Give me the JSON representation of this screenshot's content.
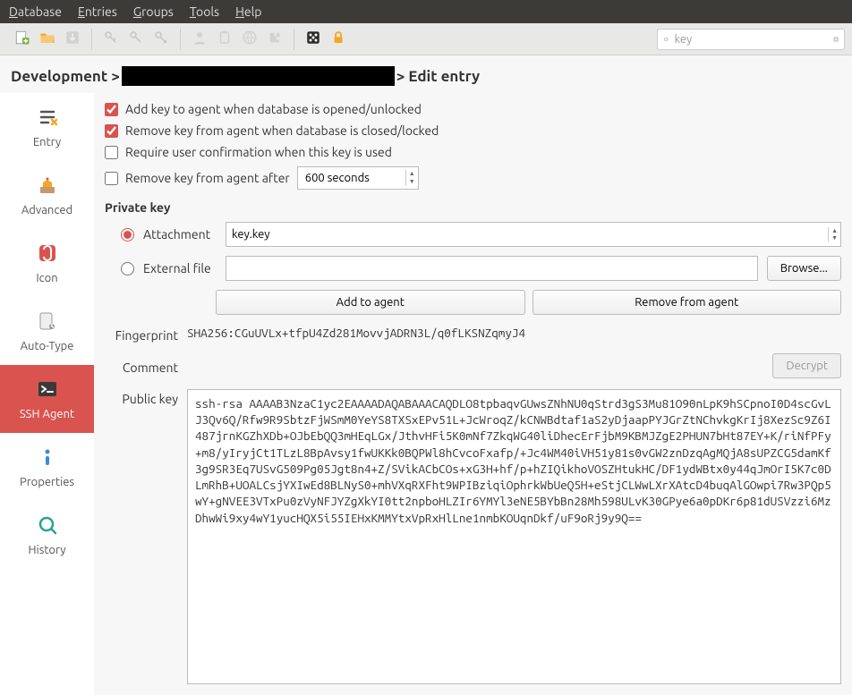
{
  "menu": {
    "database": "Database",
    "entries": "Entries",
    "groups": "Groups",
    "tools": "Tools",
    "help": "Help"
  },
  "search": {
    "placeholder": "key"
  },
  "breadcrumb": {
    "root": "Development",
    "tail": "Edit entry"
  },
  "tabs": {
    "entry": "Entry",
    "advanced": "Advanced",
    "icon": "Icon",
    "autotype": "Auto-Type",
    "sshagent": "SSH Agent",
    "properties": "Properties",
    "history": "History"
  },
  "ssh": {
    "add_open": "Add key to agent when database is opened/unlocked",
    "remove_close": "Remove key from agent when database is closed/locked",
    "require_confirm": "Require user confirmation when this key is used",
    "remove_after": "Remove key from agent after",
    "remove_after_value": "600 seconds",
    "private_key": "Private key",
    "attachment": "Attachment",
    "attachment_value": "key.key",
    "external": "External file",
    "browse": "Browse...",
    "add_agent": "Add to agent",
    "remove_agent": "Remove from agent",
    "fingerprint": "Fingerprint",
    "fingerprint_value": "SHA256:CGuUVLx+tfpU4Zd281MovvjADRN3L/q0fLKSNZqmyJ4",
    "comment": "Comment",
    "decrypt": "Decrypt",
    "public_key": "Public key",
    "public_key_value": "ssh-rsa AAAAB3NzaC1yc2EAAAADAQABAAACAQDLO8tpbaqvGUwsZNhNU0qStrd3gS3Mu81O90nLpK9hSCpnoI0D4scGvLJ3Qv6Q/Rfw9R9SbtzFjWSmM0YeYS8TXSxEPv51L+JcWroqZ/kCNWBdtaf1aS2yDjaapPYJGrZtNChvkgKrIj8XezSc9Z6I487jrnKGZhXDb+OJbEbQQ3mHEqLGx/JthvHFi5K0mNf7ZkqWG40liDhecErFjbM9KBMJZgE2PHUN7bHt87EY+K/riNfPFy+m8/yIryjCt1TLzL8BpAvsy1fwUKKk0BQPWl8hCvcoFxafp/+Jc4WM40iVH51y81s0vGW2znDzqAgMQjA8sUPZCG5damKf3g9SR3Eq7USvG509Pg05Jgt8n4+Z/SVikACbCOs+xG3H+hf/p+hZIQikhoVOSZHtukHC/DF1ydWBtx0y44qJmOrI5K7c0DLmRhB+UOALCsjYXIwEd8BLNyS0+mhVXqRXFht9WPIBziqiOphrkWbUeQ5H+eStjCLWwLXrXAtcD4buqAlGOwpi7Rw3PQp5wY+gNVEE3VTxPu0zVyNFJYZgXkYI0tt2npboHLZIr6YMYl3eNE5BYbBn28Mh598ULvK30GPye6a0pDKr6p81dUSVzzi6MzDhwWi9xy4wY1yucHQX5i55IEHxKMMYtxVpRxHlLne1nmbKOUqnDkf/uF9oRj9y9Q=="
  }
}
